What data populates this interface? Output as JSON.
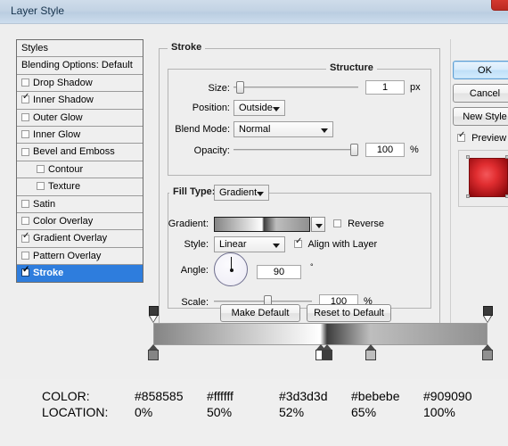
{
  "window": {
    "title": "Layer Style",
    "close_icon": "close-icon"
  },
  "styles_panel": {
    "header": "Styles",
    "blending_options": "Blending Options: Default",
    "items": [
      {
        "label": "Drop Shadow",
        "checked": false,
        "indent": 0,
        "selected": false
      },
      {
        "label": "Inner Shadow",
        "checked": true,
        "indent": 0,
        "selected": false
      },
      {
        "label": "Outer Glow",
        "checked": false,
        "indent": 0,
        "selected": false
      },
      {
        "label": "Inner Glow",
        "checked": false,
        "indent": 0,
        "selected": false
      },
      {
        "label": "Bevel and Emboss",
        "checked": false,
        "indent": 0,
        "selected": false
      },
      {
        "label": "Contour",
        "checked": false,
        "indent": 1,
        "selected": false
      },
      {
        "label": "Texture",
        "checked": false,
        "indent": 1,
        "selected": false
      },
      {
        "label": "Satin",
        "checked": false,
        "indent": 0,
        "selected": false
      },
      {
        "label": "Color Overlay",
        "checked": false,
        "indent": 0,
        "selected": false
      },
      {
        "label": "Gradient Overlay",
        "checked": true,
        "indent": 0,
        "selected": false
      },
      {
        "label": "Pattern Overlay",
        "checked": false,
        "indent": 0,
        "selected": false
      },
      {
        "label": "Stroke",
        "checked": true,
        "indent": 0,
        "selected": true
      }
    ]
  },
  "stroke": {
    "group_title": "Stroke",
    "structure": {
      "group_title": "Structure",
      "size_label": "Size:",
      "size_value": "1",
      "size_unit": "px",
      "size_slider_pct": 2,
      "position_label": "Position:",
      "position_value": "Outside",
      "blend_mode_label": "Blend Mode:",
      "blend_mode_value": "Normal",
      "opacity_label": "Opacity:",
      "opacity_value": "100",
      "opacity_unit": "%",
      "opacity_slider_pct": 100
    },
    "fill": {
      "fill_type_label": "Fill Type:",
      "fill_type_value": "Gradient",
      "gradient_label": "Gradient:",
      "reverse_label": "Reverse",
      "reverse_checked": false,
      "style_label": "Style:",
      "style_value": "Linear",
      "align_label": "Align with Layer",
      "align_checked": true,
      "angle_label": "Angle:",
      "angle_value": "90",
      "angle_unit": "°",
      "scale_label": "Scale:",
      "scale_value": "100",
      "scale_unit": "%",
      "scale_slider_pct": 55
    },
    "make_default_label": "Make Default",
    "reset_default_label": "Reset to Default"
  },
  "actions": {
    "ok_label": "OK",
    "cancel_label": "Cancel",
    "new_style_label": "New Style",
    "preview_label": "Preview",
    "preview_checked": true
  },
  "gradient_editor": {
    "top_stops": [
      {
        "location_pct": 0,
        "opacity_pct": 100
      },
      {
        "location_pct": 100,
        "opacity_pct": 100
      }
    ],
    "bottom_stops": [
      {
        "location_pct": 0,
        "color": "#858585"
      },
      {
        "location_pct": 50,
        "color": "#ffffff"
      },
      {
        "location_pct": 52,
        "color": "#3d3d3d"
      },
      {
        "location_pct": 65,
        "color": "#bebebe"
      },
      {
        "location_pct": 100,
        "color": "#909090"
      }
    ]
  },
  "color_table": {
    "row_labels": [
      "COLOR:",
      "LOCATION:"
    ],
    "colors": [
      "#858585",
      "#ffffff",
      "#3d3d3d",
      "#bebebe",
      "#909090"
    ],
    "locations": [
      "0%",
      "50%",
      "52%",
      "65%",
      "100%"
    ]
  }
}
